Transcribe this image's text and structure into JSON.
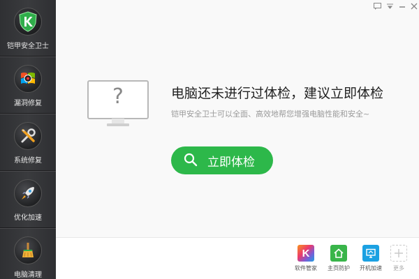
{
  "sidebar": {
    "items": [
      {
        "label": "铠甲安全卫士",
        "icon": "shield-k-icon"
      },
      {
        "label": "漏洞修复",
        "icon": "windows-bug-icon"
      },
      {
        "label": "系统修复",
        "icon": "tools-icon"
      },
      {
        "label": "优化加速",
        "icon": "rocket-icon"
      },
      {
        "label": "电脑清理",
        "icon": "broom-icon"
      }
    ]
  },
  "window_controls": {
    "feedback": "feedback-icon",
    "menu": "menu-icon",
    "minimize": "minimize-icon",
    "close": "close-icon"
  },
  "main": {
    "headline": "电脑还未进行过体检，建议立即体检",
    "subtitle": "铠甲安全卫士可以全面、高效地帮您增强电脑性能和安全~",
    "monitor_glyph": "?",
    "scan_button": "立即体检"
  },
  "tools": [
    {
      "label": "软件管家",
      "icon": "software-manager-icon",
      "color": "#f7941d"
    },
    {
      "label": "主页防护",
      "icon": "home-protect-icon",
      "color": "#39b54a"
    },
    {
      "label": "开机加速",
      "icon": "boot-speed-icon",
      "color": "#1ba1e2"
    },
    {
      "label": "更多",
      "icon": "plus-icon",
      "color": "#cccccc"
    }
  ],
  "colors": {
    "accent_green": "#2db84a",
    "sidebar_bg": "#333437"
  }
}
